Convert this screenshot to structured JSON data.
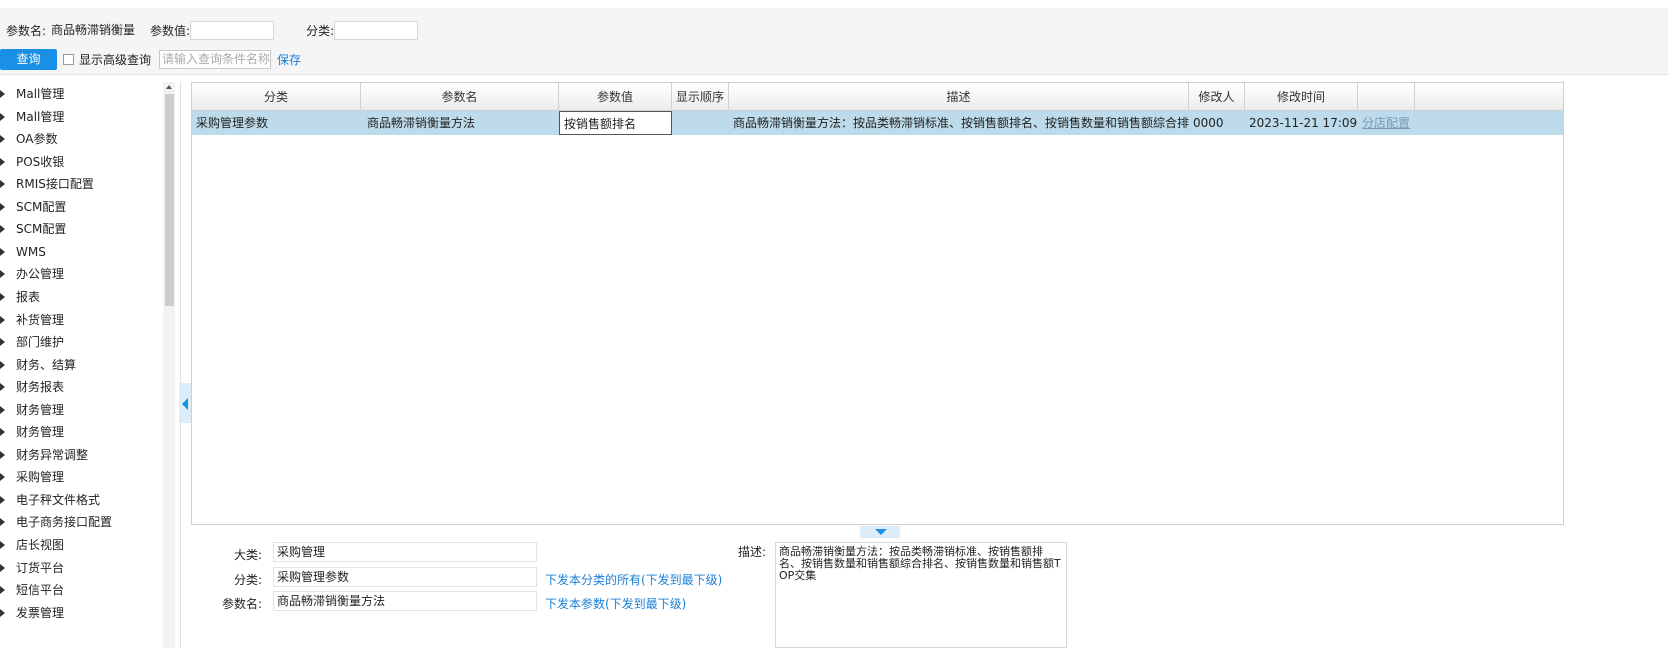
{
  "search": {
    "param_name_label": "参数名:",
    "param_name_value": "商品畅滞销衡量方",
    "param_value_label": "参数值:",
    "param_value_value": "",
    "category_label": "分类:",
    "category_value": "",
    "query_button": "查询",
    "advanced_label": "显示高级查询",
    "condition_placeholder": "请输入查询条件名称",
    "save_link": "保存"
  },
  "sidebar": {
    "items": [
      "Mall管理",
      "Mall管理",
      "OA参数",
      "POS收银",
      "RMIS接口配置",
      "SCM配置",
      "SCM配置",
      "WMS",
      "办公管理",
      "报表",
      "补货管理",
      "部门维护",
      "财务、结算",
      "财务报表",
      "财务管理",
      "财务管理",
      "财务异常调整",
      "采购管理",
      "电子秤文件格式",
      "电子商务接口配置",
      "店长视图",
      "订货平台",
      "短信平台",
      "发票管理"
    ]
  },
  "grid": {
    "headers": [
      "分类",
      "参数名",
      "参数值",
      "显示顺序",
      "描述",
      "修改人",
      "修改时间",
      ""
    ],
    "rows": [
      {
        "category": "采购管理参数",
        "name": "商品畅滞销衡量方法",
        "value": "按销售额排名",
        "order": "",
        "description": "商品畅滞销衡量方法：按品类畅滞销标准、按销售额排名、按销售数量和销售额综合排名、按销售数量和销售额TOP交集",
        "modifier": "0000",
        "modified_time": "2023-11-21 17:09:19",
        "action": "分店配置"
      }
    ]
  },
  "detail": {
    "major_label": "大类:",
    "major_value": "采购管理",
    "category_label": "分类:",
    "category_value": "采购管理参数",
    "name_label": "参数名:",
    "name_value": "商品畅滞销衡量方法",
    "distribute_category_link": "下发本分类的所有(下发到最下级)",
    "distribute_param_link": "下发本参数(下发到最下级)",
    "description_label": "描述:",
    "description_value": "商品畅滞销衡量方法：按品类畅滞销标准、按销售额排名、按销售数量和销售额综合排名、按销售数量和销售额TOP交集"
  }
}
